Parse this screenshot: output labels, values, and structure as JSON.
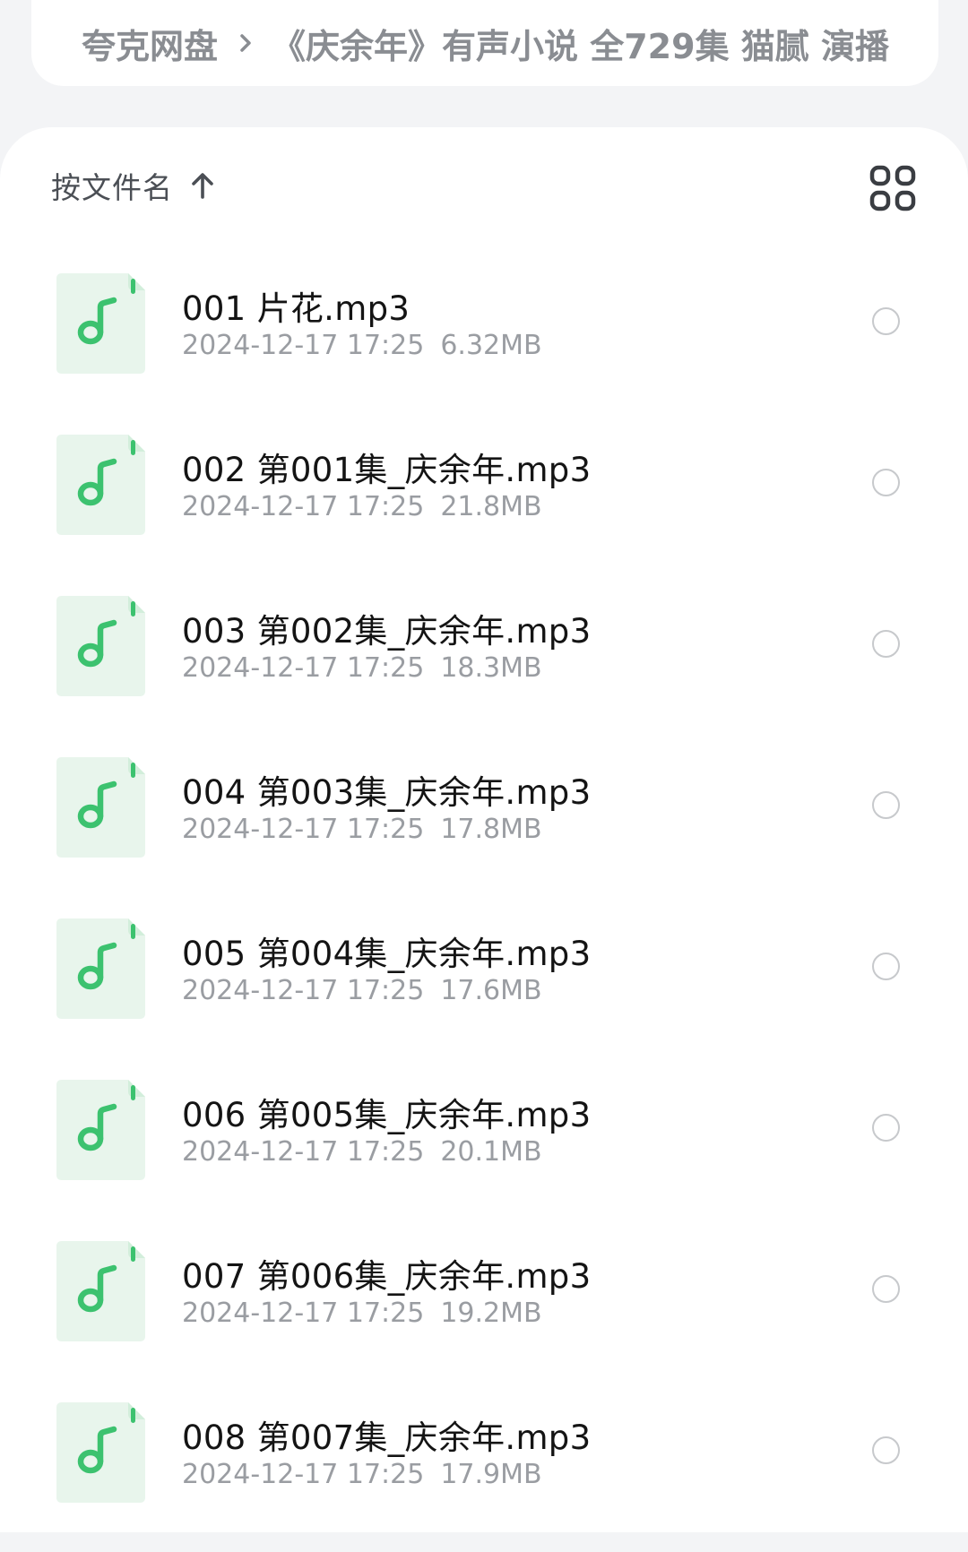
{
  "breadcrumb": {
    "root": "夸克网盘",
    "separator_icon": "chevron-right-icon",
    "current": "《庆余年》有声小说 全729集 猫腻 演播"
  },
  "toolbar": {
    "sort_label": "按文件名",
    "sort_icon": "arrow-up-icon",
    "view_toggle_icon": "grid-view-icon"
  },
  "colors": {
    "background": "#f3f4f6",
    "audio_icon_bg": "#e8f5ec",
    "audio_icon_accent": "#3cc26f",
    "meta_text": "#9a9da2"
  },
  "files": [
    {
      "name": "001 片花.mp3",
      "date": "2024-12-17 17:25",
      "size": "6.32MB"
    },
    {
      "name": "002 第001集_庆余年.mp3",
      "date": "2024-12-17 17:25",
      "size": "21.8MB"
    },
    {
      "name": "003 第002集_庆余年.mp3",
      "date": "2024-12-17 17:25",
      "size": "18.3MB"
    },
    {
      "name": "004 第003集_庆余年.mp3",
      "date": "2024-12-17 17:25",
      "size": "17.8MB"
    },
    {
      "name": "005 第004集_庆余年.mp3",
      "date": "2024-12-17 17:25",
      "size": "17.6MB"
    },
    {
      "name": "006 第005集_庆余年.mp3",
      "date": "2024-12-17 17:25",
      "size": "20.1MB"
    },
    {
      "name": "007 第006集_庆余年.mp3",
      "date": "2024-12-17 17:25",
      "size": "19.2MB"
    },
    {
      "name": "008 第007集_庆余年.mp3",
      "date": "2024-12-17 17:25",
      "size": "17.9MB"
    }
  ]
}
